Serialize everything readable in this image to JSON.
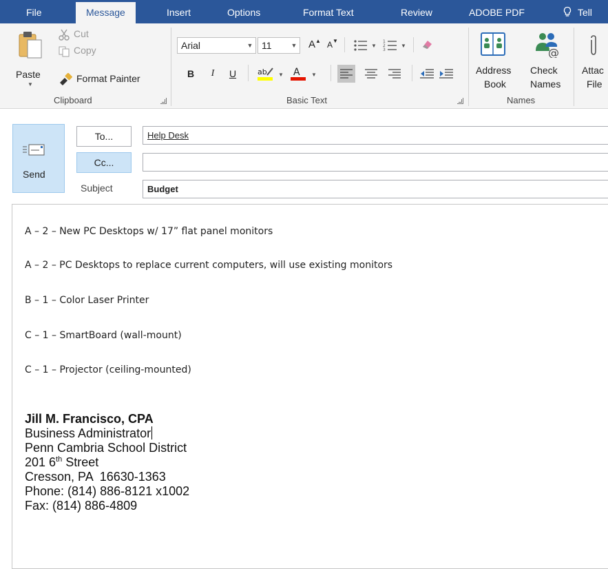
{
  "tabs": [
    {
      "label": "File"
    },
    {
      "label": "Message"
    },
    {
      "label": "Insert"
    },
    {
      "label": "Options"
    },
    {
      "label": "Format Text"
    },
    {
      "label": "Review"
    },
    {
      "label": "ADOBE PDF"
    },
    {
      "label": "Tell"
    }
  ],
  "active_tab": "Message",
  "ribbon": {
    "clipboard": {
      "paste": "Paste",
      "cut": "Cut",
      "copy": "Copy",
      "format_painter": "Format Painter",
      "label": "Clipboard"
    },
    "basic_text": {
      "font": "Arial",
      "size": "11",
      "bold": "B",
      "italic": "I",
      "underline": "U",
      "label": "Basic Text"
    },
    "names": {
      "address_book_1": "Address",
      "address_book_2": "Book",
      "check_names_1": "Check",
      "check_names_2": "Names",
      "label": "Names"
    },
    "include": {
      "attach_1": "Attac",
      "attach_2": "File"
    }
  },
  "compose": {
    "send": "Send",
    "to_button": "To...",
    "cc_button": "Cc...",
    "to_value": "Help Desk",
    "cc_value": "",
    "subject_label": "Subject",
    "subject_value": "Budget"
  },
  "body_lines": [
    "A – 2 – New PC Desktops w/ 17” flat panel monitors",
    "A – 2 – PC Desktops to replace current computers, will use existing monitors",
    "B – 1 – Color Laser Printer",
    "C – 1 – SmartBoard (wall-mount)",
    "C – 1 – Projector (ceiling-mounted)"
  ],
  "signature": {
    "name": "Jill M. Francisco, CPA",
    "title": "Business Administrator",
    "org": "Penn Cambria School District",
    "street_num": "201 6",
    "street_sup": "th",
    "street_rest": " Street",
    "city": "Cresson, PA  16630-1363",
    "phone": "Phone: (814) 886-8121 x1002",
    "fax": "Fax: (814) 886-4809"
  },
  "colors": {
    "brand": "#2b579a",
    "ribbon": "#f4f4f4",
    "selected": "#cde4f7",
    "highlight_yellow": "#ffff00",
    "font_color_red": "#e51400"
  }
}
